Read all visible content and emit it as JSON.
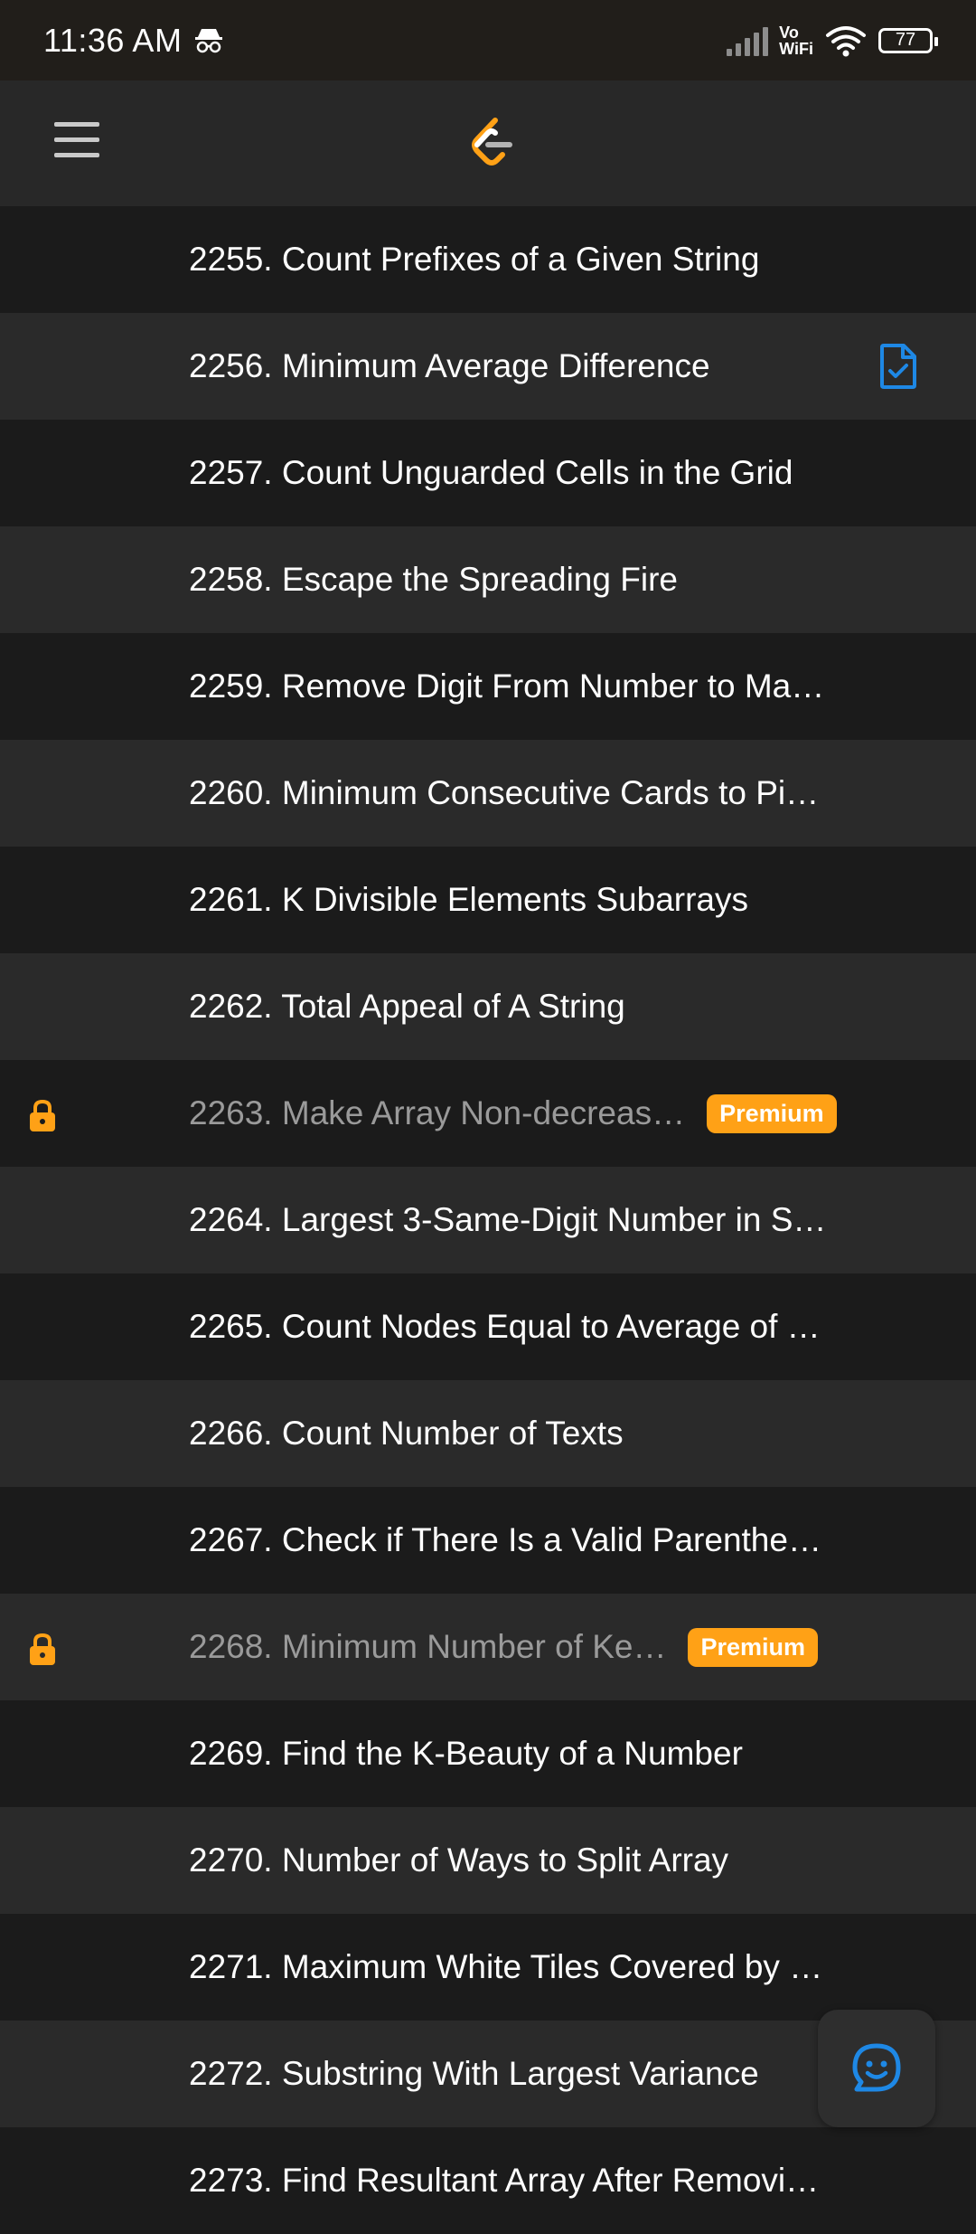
{
  "status_bar": {
    "time": "11:36 AM",
    "network_label_top": "Vo",
    "network_label_bottom": "WiFi",
    "battery": "77"
  },
  "colors": {
    "accent": "#ffa116",
    "solved": "#1e88e5",
    "row_dark": "#1b1b1b",
    "row_light": "#2a2a2a"
  },
  "problems": [
    {
      "title": "2255. Count Prefixes of a Given String"
    },
    {
      "title": "2256. Minimum Average Difference",
      "status_icon": "solved-document-icon"
    },
    {
      "title": "2257. Count Unguarded Cells in the Grid"
    },
    {
      "title": "2258. Escape the Spreading Fire"
    },
    {
      "title": "2259. Remove Digit From Number to Ma…"
    },
    {
      "title": "2260. Minimum Consecutive Cards to Pi…"
    },
    {
      "title": "2261. K Divisible Elements Subarrays"
    },
    {
      "title": "2262. Total Appeal of A String"
    },
    {
      "title": "2263. Make Array Non-decreas…",
      "badge": "Premium",
      "locked": true
    },
    {
      "title": "2264. Largest 3-Same-Digit Number in S…"
    },
    {
      "title": "2265. Count Nodes Equal to Average of …"
    },
    {
      "title": "2266. Count Number of Texts"
    },
    {
      "title": "2267. Check if There Is a Valid Parenthe…"
    },
    {
      "title": "2268. Minimum Number of Ke…",
      "badge": "Premium",
      "locked": true
    },
    {
      "title": "2269. Find the K-Beauty of a Number"
    },
    {
      "title": "2270. Number of Ways to Split Array"
    },
    {
      "title": "2271. Maximum White Tiles Covered by …"
    },
    {
      "title": "2272. Substring With Largest Variance"
    },
    {
      "title": "2273. Find Resultant Array After Removi…"
    }
  ]
}
